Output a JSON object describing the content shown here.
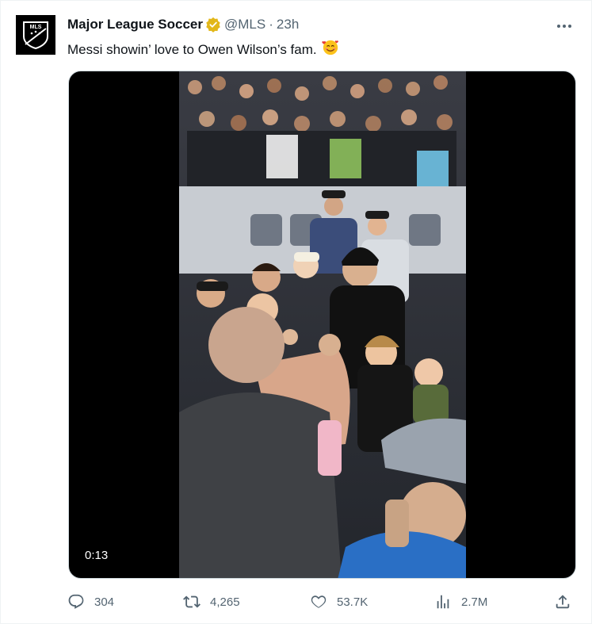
{
  "account": {
    "display_name": "Major League Soccer",
    "handle": "@MLS",
    "separator": "·",
    "time_ago": "23h",
    "avatar_text": "MLS"
  },
  "tweet": {
    "text": "Messi showin’ love to Owen Wilson’s fam.",
    "emoji": "smiling-face-with-hearts"
  },
  "media": {
    "duration": "0:13"
  },
  "actions": {
    "replies": "304",
    "retweets": "4,265",
    "likes": "53.7K",
    "views": "2.7M"
  },
  "colors": {
    "text_primary": "#0f1419",
    "text_secondary": "#536471",
    "verified_gold": "#e2b719",
    "media_bg": "#000000"
  },
  "icons": [
    "more-icon",
    "verified-badge-icon",
    "reply-icon",
    "retweet-icon",
    "like-icon",
    "views-icon",
    "share-icon"
  ]
}
